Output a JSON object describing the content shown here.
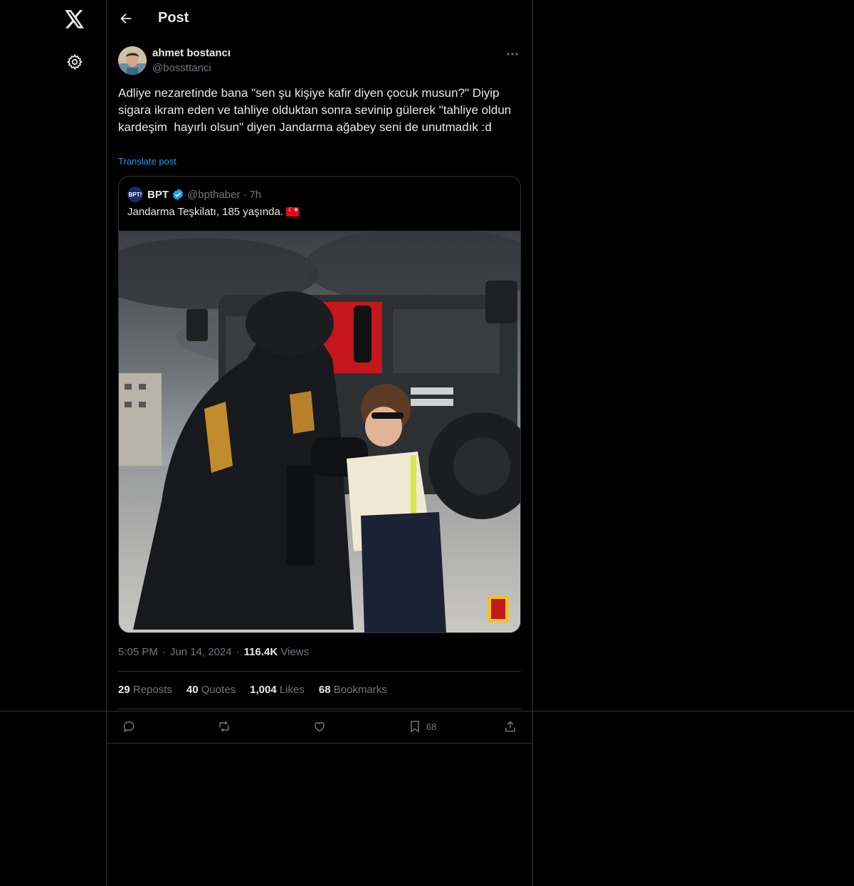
{
  "header": {
    "title": "Post"
  },
  "author": {
    "name": "ahmet bostancı",
    "handle": "@bossttanci"
  },
  "post": {
    "text": "Adliye nezaretinde bana \"sen şu kişiye kafir diyen çocuk musun?\" Diyip sigara ikram eden ve tahliye olduktan sonra sevinip gülerek \"tahliye oldun kardeşim  hayırlı olsun\" diyen Jandarma ağabey seni de unutmadık :d",
    "translate_label": "Translate post"
  },
  "quote": {
    "avatar_text": "BPT!",
    "name": "BPT",
    "handle": "@bpthaber",
    "dot": "·",
    "time": "7h",
    "text": "Jandarma Teşkilatı, 185 yaşında."
  },
  "meta": {
    "time": "5:05 PM",
    "dot1": "·",
    "date": "Jun 14, 2024",
    "dot2": "·",
    "views_count": "116.4K",
    "views_label": "Views"
  },
  "stats": {
    "reposts_count": "29",
    "reposts_label": "Reposts",
    "quotes_count": "40",
    "quotes_label": "Quotes",
    "likes_count": "1,004",
    "likes_label": "Likes",
    "bookmarks_count": "68",
    "bookmarks_label": "Bookmarks"
  },
  "actions": {
    "bookmark_count": "68"
  },
  "colors": {
    "background": "#000000",
    "border": "#2f3336",
    "text": "#e7e9ea",
    "muted": "#71767b",
    "accent": "#1d9bf0"
  },
  "icons": [
    "x-logo-icon",
    "gear-icon",
    "back-arrow-icon",
    "more-icon",
    "verified-icon",
    "turkish-flag-icon",
    "reply-icon",
    "repost-icon",
    "like-icon",
    "bookmark-icon",
    "share-icon"
  ]
}
